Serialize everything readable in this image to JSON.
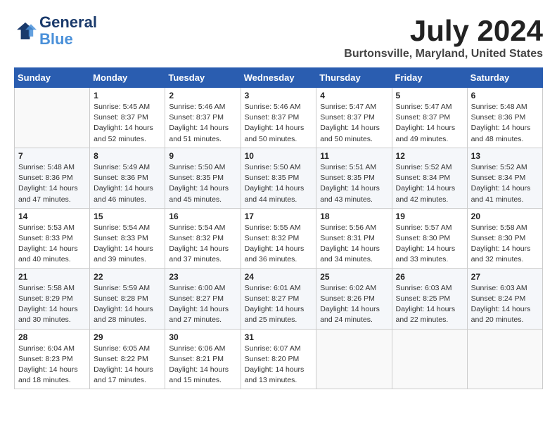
{
  "header": {
    "logo_line1": "General",
    "logo_line2": "Blue",
    "month": "July 2024",
    "location": "Burtonsville, Maryland, United States"
  },
  "days_of_week": [
    "Sunday",
    "Monday",
    "Tuesday",
    "Wednesday",
    "Thursday",
    "Friday",
    "Saturday"
  ],
  "weeks": [
    [
      {
        "day": "",
        "empty": true
      },
      {
        "day": "1",
        "sunrise": "Sunrise: 5:45 AM",
        "sunset": "Sunset: 8:37 PM",
        "daylight": "Daylight: 14 hours and 52 minutes."
      },
      {
        "day": "2",
        "sunrise": "Sunrise: 5:46 AM",
        "sunset": "Sunset: 8:37 PM",
        "daylight": "Daylight: 14 hours and 51 minutes."
      },
      {
        "day": "3",
        "sunrise": "Sunrise: 5:46 AM",
        "sunset": "Sunset: 8:37 PM",
        "daylight": "Daylight: 14 hours and 50 minutes."
      },
      {
        "day": "4",
        "sunrise": "Sunrise: 5:47 AM",
        "sunset": "Sunset: 8:37 PM",
        "daylight": "Daylight: 14 hours and 50 minutes."
      },
      {
        "day": "5",
        "sunrise": "Sunrise: 5:47 AM",
        "sunset": "Sunset: 8:37 PM",
        "daylight": "Daylight: 14 hours and 49 minutes."
      },
      {
        "day": "6",
        "sunrise": "Sunrise: 5:48 AM",
        "sunset": "Sunset: 8:36 PM",
        "daylight": "Daylight: 14 hours and 48 minutes."
      }
    ],
    [
      {
        "day": "7",
        "sunrise": "Sunrise: 5:48 AM",
        "sunset": "Sunset: 8:36 PM",
        "daylight": "Daylight: 14 hours and 47 minutes."
      },
      {
        "day": "8",
        "sunrise": "Sunrise: 5:49 AM",
        "sunset": "Sunset: 8:36 PM",
        "daylight": "Daylight: 14 hours and 46 minutes."
      },
      {
        "day": "9",
        "sunrise": "Sunrise: 5:50 AM",
        "sunset": "Sunset: 8:35 PM",
        "daylight": "Daylight: 14 hours and 45 minutes."
      },
      {
        "day": "10",
        "sunrise": "Sunrise: 5:50 AM",
        "sunset": "Sunset: 8:35 PM",
        "daylight": "Daylight: 14 hours and 44 minutes."
      },
      {
        "day": "11",
        "sunrise": "Sunrise: 5:51 AM",
        "sunset": "Sunset: 8:35 PM",
        "daylight": "Daylight: 14 hours and 43 minutes."
      },
      {
        "day": "12",
        "sunrise": "Sunrise: 5:52 AM",
        "sunset": "Sunset: 8:34 PM",
        "daylight": "Daylight: 14 hours and 42 minutes."
      },
      {
        "day": "13",
        "sunrise": "Sunrise: 5:52 AM",
        "sunset": "Sunset: 8:34 PM",
        "daylight": "Daylight: 14 hours and 41 minutes."
      }
    ],
    [
      {
        "day": "14",
        "sunrise": "Sunrise: 5:53 AM",
        "sunset": "Sunset: 8:33 PM",
        "daylight": "Daylight: 14 hours and 40 minutes."
      },
      {
        "day": "15",
        "sunrise": "Sunrise: 5:54 AM",
        "sunset": "Sunset: 8:33 PM",
        "daylight": "Daylight: 14 hours and 39 minutes."
      },
      {
        "day": "16",
        "sunrise": "Sunrise: 5:54 AM",
        "sunset": "Sunset: 8:32 PM",
        "daylight": "Daylight: 14 hours and 37 minutes."
      },
      {
        "day": "17",
        "sunrise": "Sunrise: 5:55 AM",
        "sunset": "Sunset: 8:32 PM",
        "daylight": "Daylight: 14 hours and 36 minutes."
      },
      {
        "day": "18",
        "sunrise": "Sunrise: 5:56 AM",
        "sunset": "Sunset: 8:31 PM",
        "daylight": "Daylight: 14 hours and 34 minutes."
      },
      {
        "day": "19",
        "sunrise": "Sunrise: 5:57 AM",
        "sunset": "Sunset: 8:30 PM",
        "daylight": "Daylight: 14 hours and 33 minutes."
      },
      {
        "day": "20",
        "sunrise": "Sunrise: 5:58 AM",
        "sunset": "Sunset: 8:30 PM",
        "daylight": "Daylight: 14 hours and 32 minutes."
      }
    ],
    [
      {
        "day": "21",
        "sunrise": "Sunrise: 5:58 AM",
        "sunset": "Sunset: 8:29 PM",
        "daylight": "Daylight: 14 hours and 30 minutes."
      },
      {
        "day": "22",
        "sunrise": "Sunrise: 5:59 AM",
        "sunset": "Sunset: 8:28 PM",
        "daylight": "Daylight: 14 hours and 28 minutes."
      },
      {
        "day": "23",
        "sunrise": "Sunrise: 6:00 AM",
        "sunset": "Sunset: 8:27 PM",
        "daylight": "Daylight: 14 hours and 27 minutes."
      },
      {
        "day": "24",
        "sunrise": "Sunrise: 6:01 AM",
        "sunset": "Sunset: 8:27 PM",
        "daylight": "Daylight: 14 hours and 25 minutes."
      },
      {
        "day": "25",
        "sunrise": "Sunrise: 6:02 AM",
        "sunset": "Sunset: 8:26 PM",
        "daylight": "Daylight: 14 hours and 24 minutes."
      },
      {
        "day": "26",
        "sunrise": "Sunrise: 6:03 AM",
        "sunset": "Sunset: 8:25 PM",
        "daylight": "Daylight: 14 hours and 22 minutes."
      },
      {
        "day": "27",
        "sunrise": "Sunrise: 6:03 AM",
        "sunset": "Sunset: 8:24 PM",
        "daylight": "Daylight: 14 hours and 20 minutes."
      }
    ],
    [
      {
        "day": "28",
        "sunrise": "Sunrise: 6:04 AM",
        "sunset": "Sunset: 8:23 PM",
        "daylight": "Daylight: 14 hours and 18 minutes."
      },
      {
        "day": "29",
        "sunrise": "Sunrise: 6:05 AM",
        "sunset": "Sunset: 8:22 PM",
        "daylight": "Daylight: 14 hours and 17 minutes."
      },
      {
        "day": "30",
        "sunrise": "Sunrise: 6:06 AM",
        "sunset": "Sunset: 8:21 PM",
        "daylight": "Daylight: 14 hours and 15 minutes."
      },
      {
        "day": "31",
        "sunrise": "Sunrise: 6:07 AM",
        "sunset": "Sunset: 8:20 PM",
        "daylight": "Daylight: 14 hours and 13 minutes."
      },
      {
        "day": "",
        "empty": true
      },
      {
        "day": "",
        "empty": true
      },
      {
        "day": "",
        "empty": true
      }
    ]
  ]
}
